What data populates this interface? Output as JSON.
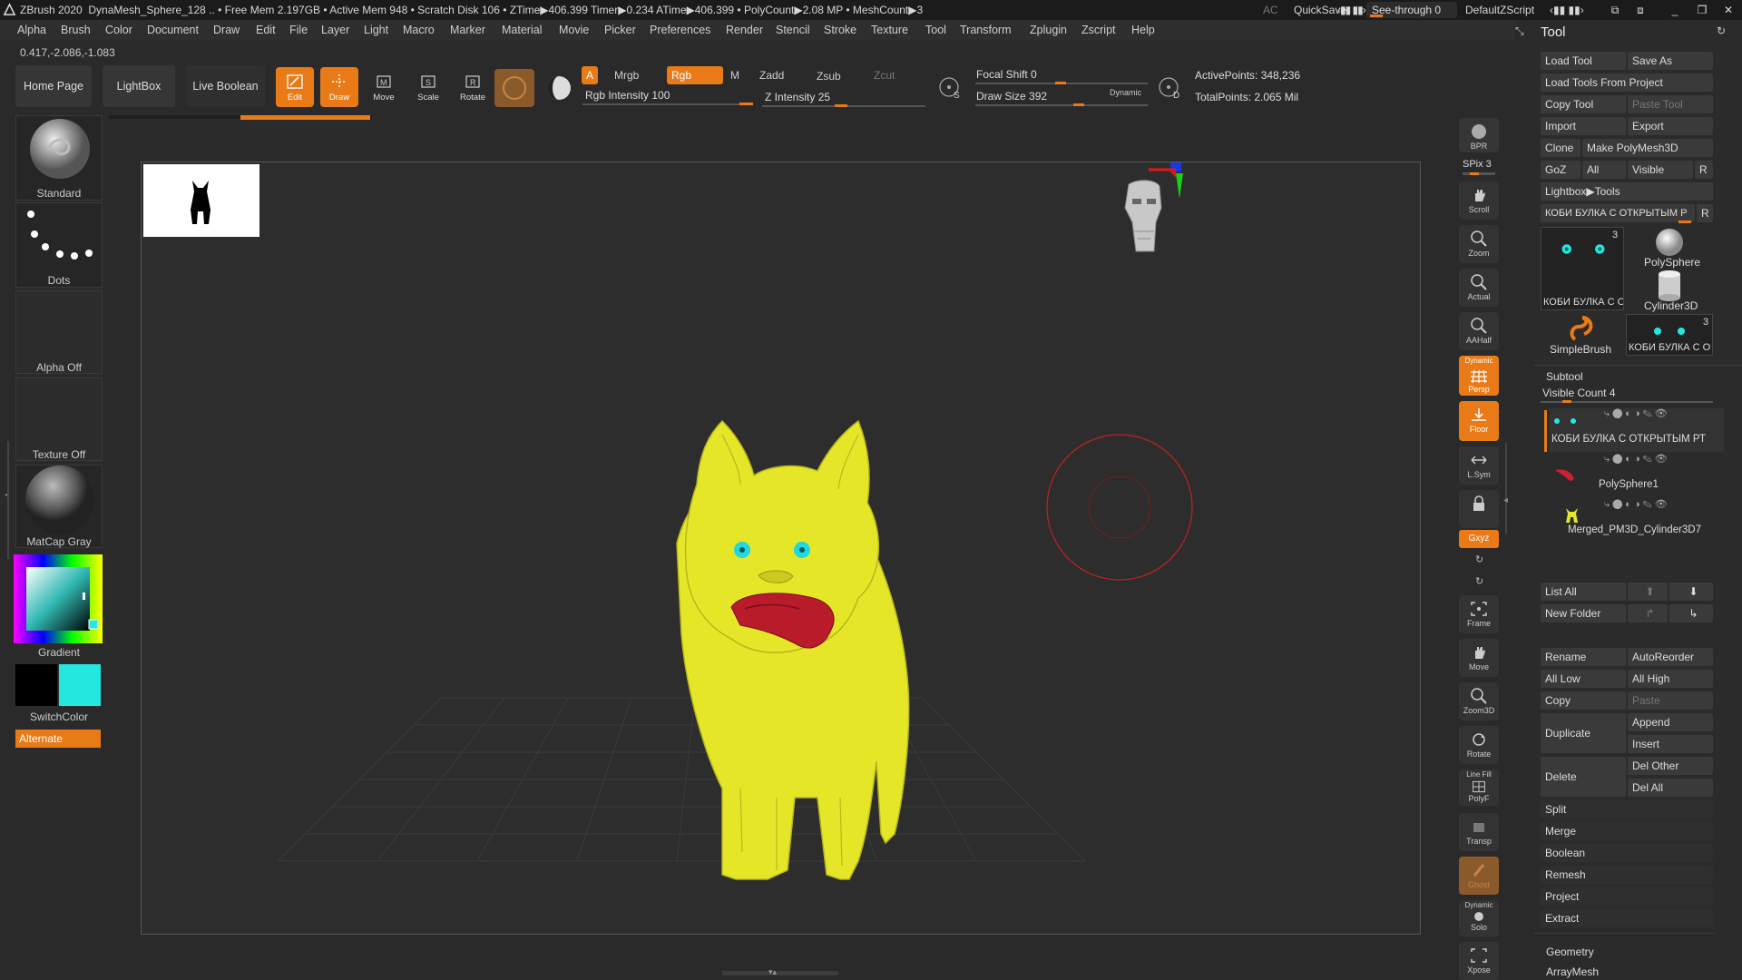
{
  "titlebar": {
    "app": "ZBrush 2020",
    "status": "DynaMesh_Sphere_128  .. • Free Mem 2.197GB • Active Mem 948 • Scratch Disk 106 • ZTime▶406.399 Timer▶0.234 ATime▶406.399 • PolyCount▶2.08 MP  • MeshCount▶3",
    "ac": "AC",
    "quicksave": "QuickSave",
    "seethrough": "See-through  0",
    "script": "DefaultZScript"
  },
  "menu": [
    "Alpha",
    "Brush",
    "Color",
    "Document",
    "Draw",
    "Edit",
    "File",
    "Layer",
    "Light",
    "Macro",
    "Marker",
    "Material",
    "Movie",
    "Picker",
    "Preferences",
    "Render",
    "Stencil",
    "Stroke",
    "Texture",
    "Tool",
    "Transform",
    "Zplugin",
    "Zscript",
    "Help"
  ],
  "coords": "0.417,-2.086,-1.083",
  "shelf": {
    "home": "Home Page",
    "lightbox": "LightBox",
    "liveboolean": "Live Boolean",
    "edit": "Edit",
    "draw": "Draw",
    "move": "Move",
    "scale": "Scale",
    "rotate": "Rotate",
    "a": "A",
    "mrgb": "Mrgb",
    "rgb": "Rgb",
    "m": "M",
    "zadd": "Zadd",
    "zsub": "Zsub",
    "zcut": "Zcut",
    "rgb_intensity": "Rgb Intensity 100",
    "z_intensity": "Z Intensity 25",
    "focal_shift": "Focal Shift 0",
    "draw_size": "Draw Size 392",
    "dynamic": "Dynamic",
    "active_points": "ActivePoints: 348,236",
    "total_points": "TotalPoints: 2.065 Mil",
    "s": "S",
    "d": "D"
  },
  "left": {
    "standard": "Standard",
    "dots": "Dots",
    "alpha_off": "Alpha Off",
    "texture_off": "Texture Off",
    "matcap": "MatCap Gray",
    "gradient": "Gradient",
    "switchcolor": "SwitchColor",
    "alternate": "Alternate"
  },
  "rightbar": {
    "bpr": "BPR",
    "spix": "SPix 3",
    "scroll": "Scroll",
    "zoom": "Zoom",
    "actual": "Actual",
    "aahalf": "AAHalf",
    "persp": "Persp",
    "dynamic_label": "Dynamic",
    "floor": "Floor",
    "lsym": "L.Sym",
    "xyz": "Gxyz",
    "frame": "Frame",
    "move": "Move",
    "zoom3d": "Zoom3D",
    "rotate": "Rotate",
    "linefill": "Line Fill",
    "polyf": "PolyF",
    "transp": "Transp",
    "ghost": "Ghost",
    "dynamic2": "Dynamic",
    "solo": "Solo",
    "xpose": "Xpose"
  },
  "tool": {
    "title": "Tool",
    "load_tool": "Load Tool",
    "save_as": "Save As",
    "load_from_project": "Load Tools From Project",
    "copy_tool": "Copy Tool",
    "paste_tool": "Paste Tool",
    "import": "Import",
    "export": "Export",
    "clone": "Clone",
    "make_polymesh": "Make PolyMesh3D",
    "goz": "GoZ",
    "all": "All",
    "visible": "Visible",
    "r": "R",
    "lightbox_tools": "Lightbox▶Tools",
    "current_tool": "КОБИ БУЛКА С ОТКРЫТЫМ Р",
    "thumb_count_1": "3",
    "thumb_label_1": "КОБИ БУЛКА С О",
    "polysphere": "PolySphere",
    "cylinder": "Cylinder3D",
    "simplebrush": "SimpleBrush",
    "thumb_count_2": "3",
    "thumb_label_2": "КОБИ БУЛКА С О",
    "subtool": "Subtool",
    "visible_count": "Visible Count 4",
    "subtools": [
      "КОБИ БУЛКА С ОТКРЫТЫМ РТ",
      "PolySphere1",
      "Merged_PM3D_Cylinder3D7"
    ],
    "list_all": "List All",
    "new_folder": "New Folder",
    "rename": "Rename",
    "autoreorder": "AutoReorder",
    "all_low": "All Low",
    "all_high": "All High",
    "copy": "Copy",
    "paste": "Paste",
    "duplicate": "Duplicate",
    "append": "Append",
    "insert": "Insert",
    "delete": "Delete",
    "del_other": "Del Other",
    "del_all": "Del All",
    "split": "Split",
    "merge": "Merge",
    "boolean": "Boolean",
    "remesh": "Remesh",
    "project": "Project",
    "extract": "Extract",
    "geometry": "Geometry",
    "arraymesh": "ArrayMesh"
  },
  "colors": {
    "accent": "#e87b18",
    "model": "#e6e629",
    "secondary_color": "#22e8e0"
  }
}
